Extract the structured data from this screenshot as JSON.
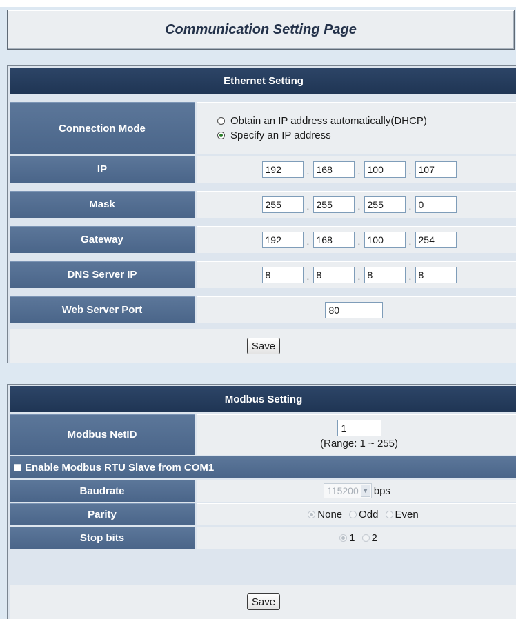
{
  "page": {
    "title": "Communication Setting Page"
  },
  "ethernet": {
    "header": "Ethernet Setting",
    "connection_mode": {
      "label": "Connection Mode",
      "options": [
        "Obtain an IP address automatically(DHCP)",
        "Specify an IP address"
      ],
      "selected": "Specify an IP address"
    },
    "ip": {
      "label": "IP",
      "octets": [
        "192",
        "168",
        "100",
        "107"
      ]
    },
    "mask": {
      "label": "Mask",
      "octets": [
        "255",
        "255",
        "255",
        "0"
      ]
    },
    "gateway": {
      "label": "Gateway",
      "octets": [
        "192",
        "168",
        "100",
        "254"
      ]
    },
    "dns": {
      "label": "DNS Server IP",
      "octets": [
        "8",
        "8",
        "8",
        "8"
      ]
    },
    "web_port": {
      "label": "Web Server Port",
      "value": "80"
    },
    "save_label": "Save"
  },
  "modbus": {
    "header": "Modbus Setting",
    "netid": {
      "label": "Modbus NetID",
      "value": "1",
      "range_text": "(Range: 1 ~ 255)"
    },
    "rtu_slave": {
      "label": "Enable Modbus RTU Slave from COM1",
      "checked": false
    },
    "baudrate": {
      "label": "Baudrate",
      "value": "115200",
      "unit": "bps"
    },
    "parity": {
      "label": "Parity",
      "options": [
        "None",
        "Odd",
        "Even"
      ],
      "selected": "None"
    },
    "stop_bits": {
      "label": "Stop bits",
      "options": [
        "1",
        "2"
      ],
      "selected": "1"
    },
    "save_label": "Save"
  }
}
